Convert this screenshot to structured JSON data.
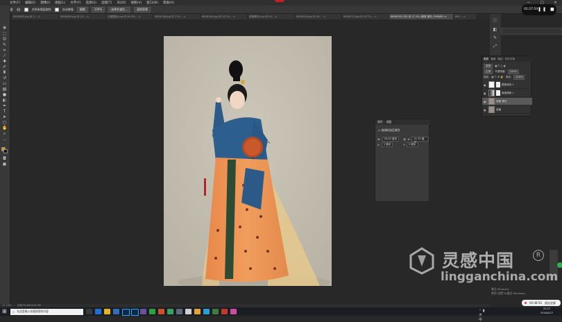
{
  "menubar": {
    "items": [
      "文件(F)",
      "编辑(E)",
      "图像(I)",
      "图层(L)",
      "文字(Y)",
      "选择(S)",
      "滤镜(T)",
      "3D(D)",
      "视图(V)",
      "窗口(W)",
      "帮助(H)"
    ]
  },
  "window_controls": [
    "—",
    "□",
    "✕"
  ],
  "options": {
    "sample_label": "对所有图层取样",
    "auto_label": "自动增强",
    "mode_label": "模糊",
    "strength": "100%",
    "btn1": "选择并遮住...",
    "btn2": "清除背景"
  },
  "tabs": [
    {
      "label": "IMG6062.jpg @ 1... ×"
    },
    {
      "label": "IMG6089.jpg @ 10... ×"
    },
    {
      "label": "汉服整组.png @ 46.4%... ×"
    },
    {
      "label": "IMG6136.jpg @ 21%... ×"
    },
    {
      "label": "IMG6164.jpg @ 16.7%... ×"
    },
    {
      "label": "背景素材.png @ 50... ×"
    },
    {
      "label": "IMG6190.jpg @ 16.... ×"
    },
    {
      "label": "IMG6212.jpg @ 16.7%... ×"
    },
    {
      "label": "IMG6232.CR2 @ 17.1% (修改 拷贝, RGB/8*) ×"
    },
    {
      "label": "IMG... ×"
    }
  ],
  "video": {
    "time": "02:27:54",
    "controls": "❚❚ ■"
  },
  "layers": {
    "tabs": [
      "图层",
      "通道",
      "路径",
      "历史记录"
    ],
    "kind": "类型",
    "blend": "正常",
    "opacity_label": "不透明度:",
    "opacity": "100%",
    "lock_label": "锁定:",
    "fill_label": "填充:",
    "fill": "100%",
    "rows": [
      {
        "name": "颜色填充 1",
        "selected": false
      },
      {
        "name": "渐变映射 1",
        "selected": false
      },
      {
        "name": "背景 拷贝",
        "selected": true
      },
      {
        "name": "背景",
        "selected": false
      }
    ]
  },
  "properties": {
    "tabs": [
      "属性",
      "调整"
    ],
    "title": "曲线的选区属性",
    "w_label": "W:",
    "w_value": "28.60 厘米",
    "h_label": "H:",
    "h_value": "41.35 厘米",
    "x_label": "X:",
    "x_value": "0 厘米",
    "y_label": "Y:",
    "y_value": "0 厘米"
  },
  "status": {
    "zoom": "17.13%",
    "doc": "文档:94.6M/433.3M"
  },
  "taskbar": {
    "search_placeholder": "在这里输入你要搜索的内容"
  },
  "clock": {
    "time": "22:27",
    "date": "2018/6/27"
  },
  "watermark": {
    "cn": "灵感中国",
    "en": "lingganchina.com",
    "reg": "R"
  },
  "activate": {
    "line1": "激活 Windows",
    "line2": "转到\"设置\"以激活 Windows。"
  },
  "rec_pill": {
    "time": "00:48:50",
    "label": "退出全屏"
  },
  "colors": {
    "accent": "#31a8ff",
    "fg": "#d4a41c",
    "bg": "#111111"
  }
}
